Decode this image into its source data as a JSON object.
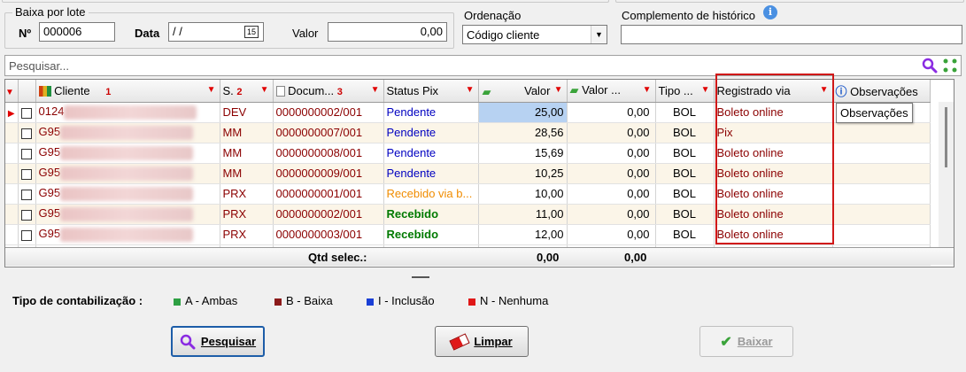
{
  "baixa_lote": {
    "title": "Baixa por lote",
    "numero_label": "Nº",
    "numero_value": "000006",
    "data_label": "Data",
    "data_value": "/ /",
    "calendar_glyph": "15",
    "valor_label": "Valor",
    "valor_value": "0,00"
  },
  "ordenacao": {
    "label": "Ordenação",
    "selected": "Código cliente"
  },
  "complemento": {
    "label": "Complemento de histórico",
    "value": ""
  },
  "search": {
    "placeholder": "Pesquisar..."
  },
  "grid": {
    "columns": [
      {
        "key": "arrow",
        "label": ""
      },
      {
        "key": "cliente",
        "label": "Cliente",
        "sort": "1"
      },
      {
        "key": "s",
        "label": "S.",
        "sort": "2"
      },
      {
        "key": "documento",
        "label": "Docum...",
        "sort": "3"
      },
      {
        "key": "status_pix",
        "label": "Status Pix"
      },
      {
        "key": "valor",
        "label": "Valor"
      },
      {
        "key": "valor2",
        "label": "Valor ..."
      },
      {
        "key": "tipo",
        "label": "Tipo ..."
      },
      {
        "key": "registrado_via",
        "label": "Registrado via"
      },
      {
        "key": "observacoes",
        "label": "Observações"
      }
    ],
    "rows": [
      {
        "cliente": "0124",
        "s": "DEV",
        "documento": "0000000002/001",
        "status_pix": "Pendente",
        "status_class": "bluetext",
        "valor": "25,00",
        "valor2": "0,00",
        "tipo": "BOL",
        "registrado_via": "Boleto online",
        "selected": true
      },
      {
        "cliente": "G95",
        "s": "MM",
        "documento": "0000000007/001",
        "status_pix": "Pendente",
        "status_class": "bluetext",
        "valor": "28,56",
        "valor2": "0,00",
        "tipo": "BOL",
        "registrado_via": "Pix"
      },
      {
        "cliente": "G95",
        "s": "MM",
        "documento": "0000000008/001",
        "status_pix": "Pendente",
        "status_class": "bluetext",
        "valor": "15,69",
        "valor2": "0,00",
        "tipo": "BOL",
        "registrado_via": "Boleto online"
      },
      {
        "cliente": "G95",
        "s": "MM",
        "documento": "0000000009/001",
        "status_pix": "Pendente",
        "status_class": "bluetext",
        "valor": "10,25",
        "valor2": "0,00",
        "tipo": "BOL",
        "registrado_via": "Boleto online"
      },
      {
        "cliente": "G95",
        "s": "PRX",
        "documento": "0000000001/001",
        "status_pix": "Recebido via b...",
        "status_class": "orange",
        "valor": "10,00",
        "valor2": "0,00",
        "tipo": "BOL",
        "registrado_via": "Boleto online"
      },
      {
        "cliente": "G95",
        "s": "PRX",
        "documento": "0000000002/001",
        "status_pix": "Recebido",
        "status_class": "green",
        "valor": "11,00",
        "valor2": "0,00",
        "tipo": "BOL",
        "registrado_via": "Boleto online"
      },
      {
        "cliente": "G95",
        "s": "PRX",
        "documento": "0000000003/001",
        "status_pix": "Recebido",
        "status_class": "green",
        "valor": "12,00",
        "valor2": "0,00",
        "tipo": "BOL",
        "registrado_via": "Boleto online"
      }
    ],
    "footer": {
      "qtd_label": "Qtd selec.:",
      "valor_total": "0,00",
      "valor2_total": "0,00"
    }
  },
  "tooltip": "Observações",
  "legend": {
    "title": "Tipo de contabilização :",
    "items": [
      {
        "label": "A - Ambas",
        "color": "#2ea043"
      },
      {
        "label": "B - Baixa",
        "color": "#8b1a1a"
      },
      {
        "label": "I - Inclusão",
        "color": "#1a3fd6"
      },
      {
        "label": "N - Nenhuma",
        "color": "#e01818"
      }
    ]
  },
  "buttons": {
    "pesquisar": "Pesquisar",
    "limpar": "Limpar",
    "baixar": "Baixar"
  },
  "colors": {
    "accent_red": "#d01818",
    "selected_row": "#b7d2f2",
    "link_blue": "#0000c0"
  }
}
